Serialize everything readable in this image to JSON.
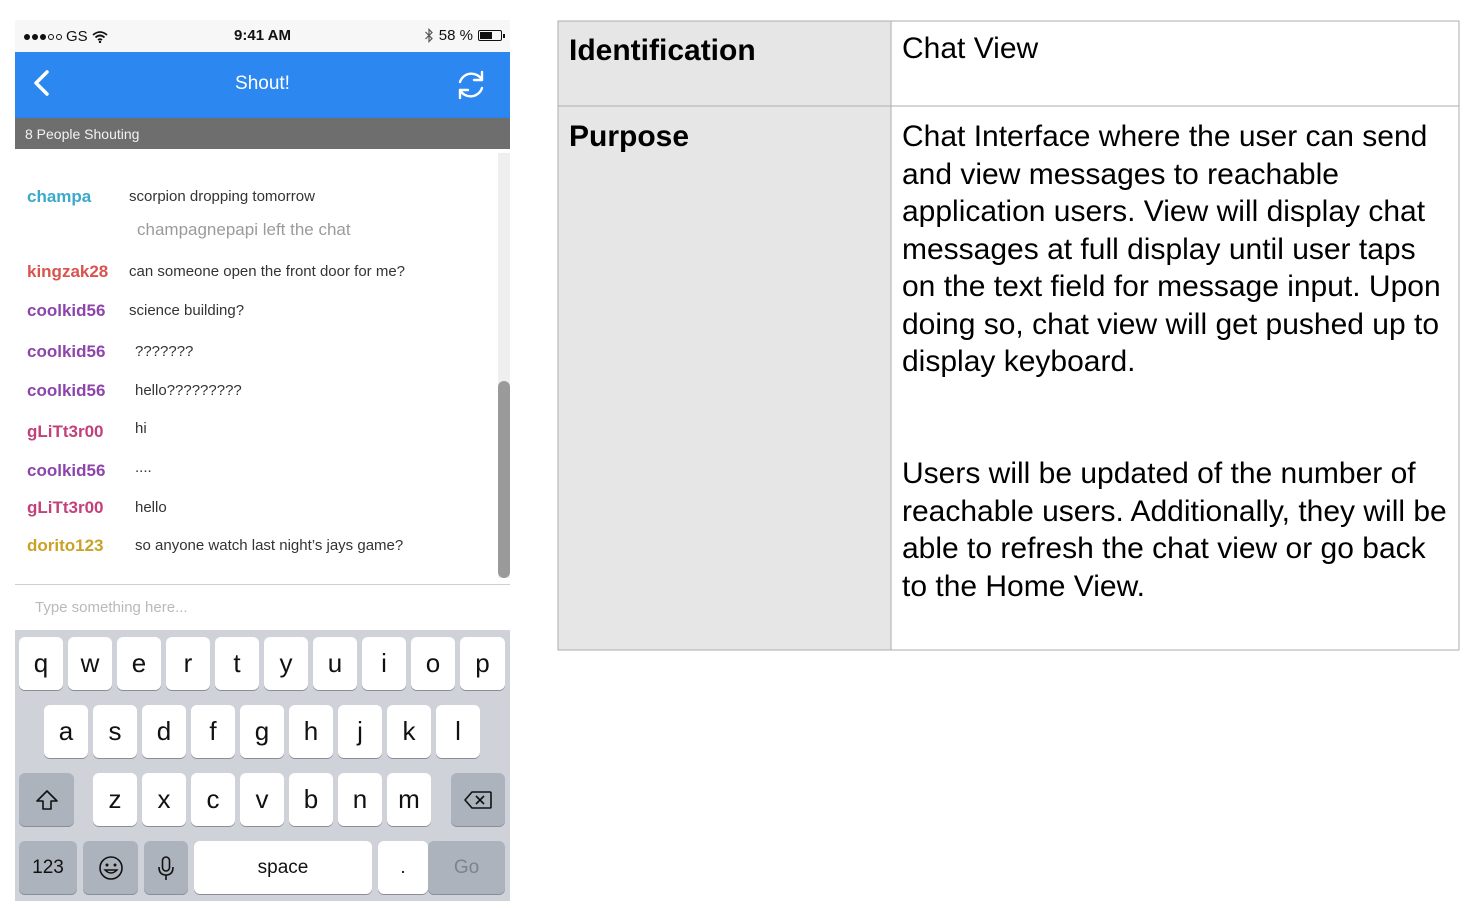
{
  "status_bar": {
    "carrier": "GS",
    "time": "9:41 AM",
    "battery_percent": "58 %",
    "battery_level": 0.58,
    "icons": [
      "signal-dots-icon",
      "wifi-icon",
      "bluetooth-icon",
      "battery-icon"
    ]
  },
  "nav": {
    "title": "Shout!",
    "back_icon": "chevron-left-icon",
    "refresh_icon": "refresh-icon",
    "color": "#2c87f0"
  },
  "subheader": "8 People Shouting",
  "messages": [
    {
      "user": "champa",
      "text": "scorpion dropping tomorrow",
      "color": "#3ba9c9"
    },
    {
      "system": "champagnepapi left the chat"
    },
    {
      "user": "kingzak28",
      "text": "can someone open the front door for me?",
      "color": "#d9534f"
    },
    {
      "user": "coolkid56",
      "text": "science building?",
      "color": "#8e44ad"
    },
    {
      "user": "coolkid56",
      "text": "???????",
      "color": "#8e44ad"
    },
    {
      "user": "coolkid56",
      "text": "hello?????????",
      "color": "#8e44ad"
    },
    {
      "user": "gLiTt3r00",
      "text": "hi",
      "color": "#c2417a"
    },
    {
      "user": "coolkid56",
      "text": "....",
      "color": "#8e44ad"
    },
    {
      "user": "gLiTt3r00",
      "text": "hello",
      "color": "#c2417a"
    },
    {
      "user": "dorito123",
      "text": "so anyone watch last night’s jays game?",
      "color": "#c9a227"
    }
  ],
  "input": {
    "placeholder": "Type something here...",
    "value": ""
  },
  "keyboard": {
    "row1": [
      "q",
      "w",
      "e",
      "r",
      "t",
      "y",
      "u",
      "i",
      "o",
      "p"
    ],
    "row2": [
      "a",
      "s",
      "d",
      "f",
      "g",
      "h",
      "j",
      "k",
      "l"
    ],
    "row3": [
      "z",
      "x",
      "c",
      "v",
      "b",
      "n",
      "m"
    ],
    "shift_icon": "shift-icon",
    "delete_icon": "delete-icon",
    "numbers_label": "123",
    "emoji_icon": "emoji-icon",
    "mic_icon": "microphone-icon",
    "space_label": "space",
    "period_label": ".",
    "go_label": "Go"
  },
  "table": {
    "rows": [
      {
        "label": "Identification",
        "value": [
          "Chat View"
        ]
      },
      {
        "label": "Purpose",
        "value": [
          "Chat Interface where the user can send and view messages to reachable application users. View will display chat messages at full display until user taps on the text field for message input. Upon doing so, chat view will get pushed up to display keyboard.",
          "Users will be updated of the number of reachable users. Additionally, they will be able to refresh the chat view or go back to the Home View."
        ]
      }
    ]
  }
}
